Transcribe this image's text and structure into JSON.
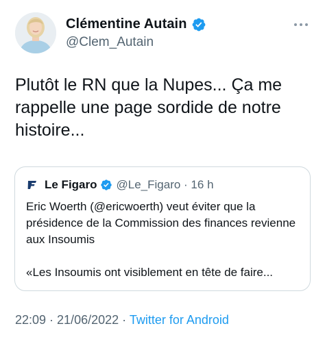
{
  "author": {
    "name": "Clémentine Autain",
    "handle": "@Clem_Autain",
    "verified": true,
    "avatar": "profile-photo"
  },
  "tweet": {
    "text": "Plutôt le RN que la Nupes... Ça me\nrappelle une page sordide de notre\nhistoire..."
  },
  "quoted_tweet": {
    "logo_icon": "le-figaro-logo-icon",
    "name": "Le Figaro",
    "handle": "@Le_Figaro",
    "time": "16 h",
    "handle_time": "@Le_Figaro · 16 h",
    "paragraphs": [
      "Eric Woerth (@ericwoerth) veut éviter que la présidence de la Commission des finances revienne aux Insoumis",
      "«Les Insoumis ont visiblement en tête de faire..."
    ]
  },
  "meta": {
    "time": "22:09",
    "date": "21/06/2022",
    "time_date": "22:09 · 21/06/2022 · ",
    "source": "Twitter for Android"
  },
  "colors": {
    "text": "#0f1419",
    "secondary": "#536471",
    "accent": "#1d9bf0",
    "border": "#cfd9de"
  }
}
